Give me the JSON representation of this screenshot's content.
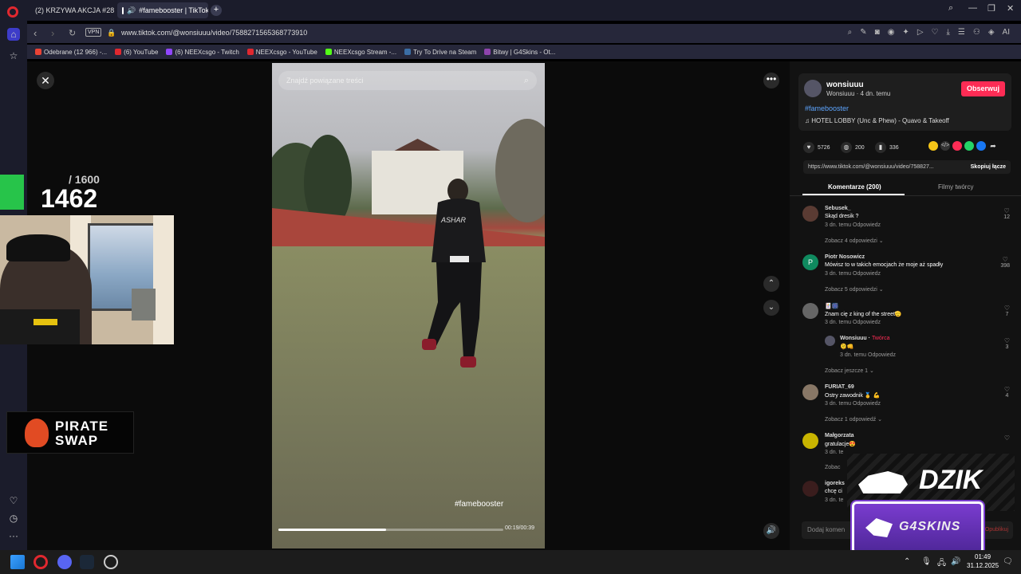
{
  "browser": {
    "tabs": [
      {
        "label": "(2) KRZYWA AKCJA #28 -",
        "color": "#e0282f"
      },
      {
        "label": "#famebooster | TikTok",
        "color": "#ffffff"
      }
    ],
    "url": "www.tiktok.com/@wonsiuuu/video/7588271565368773910",
    "vpn": "VPN",
    "bookmarks": [
      {
        "label": "Odebrane (12 966) -...",
        "color": "#ea4335"
      },
      {
        "label": "(6) YouTube",
        "color": "#e0282f"
      },
      {
        "label": "(6) NEEXcsgo - Twitch",
        "color": "#9146ff"
      },
      {
        "label": "NEEXcsgo - YouTube",
        "color": "#e0282f"
      },
      {
        "label": "NEEXcsgo Stream -...",
        "color": "#53fc18"
      },
      {
        "label": "Try To Drive na Steam",
        "color": "#3b6ea5"
      },
      {
        "label": "Bitwy | G4Skins - Ot...",
        "color": "#8e44ad"
      }
    ]
  },
  "video": {
    "search_placeholder": "Znajdź powiązane treści",
    "hashtag_overlay": "#famebooster",
    "progress": 0.48,
    "time": "00:19/00:39"
  },
  "panel": {
    "username": "wonsiuuu",
    "subline": "Wonsiuuu · 4 dn. temu",
    "follow_label": "Obserwuj",
    "hashtag": "#famebooster",
    "music": "HOTEL LOBBY (Unc & Phew) - Quavo & Takeoff",
    "likes": "5726",
    "comments_count": "200",
    "saves": "336",
    "link": "https://www.tiktok.com/@wonsiuuu/video/758827...",
    "copy_label": "Skopiuj łącze",
    "tab_comments": "Komentarze (200)",
    "tab_creator": "Filmy twórcy",
    "comments": [
      {
        "name": "Sebusek_",
        "text": "Skąd dresik ?",
        "meta": "3 dn. temu     Odpowiedz",
        "likes": "12",
        "more": "Zobacz 4 odpowiedzi ⌄",
        "avatar": "#5a3b33"
      },
      {
        "name": "Piotr Nosowicz",
        "text": "Mówisz to w takich emocjach że moje aż spadły",
        "meta": "3 dn. temu     Odpowiedz",
        "likes": "398",
        "more": "Zobacz 5 odpowiedzi ⌄",
        "avatar": "#0f8a5f",
        "initial": "P"
      },
      {
        "name": "🃏🎆",
        "text": "Znam cię z king of the street🫡",
        "meta": "3 dn. temu     Odpowiedz",
        "likes": "7",
        "more": "",
        "avatar": "#666"
      },
      {
        "name": "FURIAT_69",
        "text": "Ostry zawodnik 🥇 💪",
        "meta": "3 dn. temu     Odpowiedz",
        "likes": "4",
        "more": "Zobacz 1 odpowiedź ⌄",
        "avatar": "#887766"
      },
      {
        "name": "Małgorzata",
        "text": "gratulacje😍",
        "meta": "3 dn. te",
        "likes": "",
        "more": "Zobac",
        "avatar": "#c8b400"
      },
      {
        "name": "igoreks",
        "text": "chcę ci",
        "meta": "3 dn. te",
        "likes": "",
        "more": "",
        "avatar": "#3a1d1d"
      }
    ],
    "reply": {
      "name": "Wonsiuuu",
      "badge": "Twórca",
      "text": "🫠👊",
      "meta": "3 dn. temu     Odpowiedz",
      "likes": "3",
      "more": "Zobacz jeszcze 1 ⌄"
    },
    "add_comment": "Dodaj komen",
    "publish": "Opublikuj"
  },
  "overlay": {
    "total": "/ 1600",
    "count": "1462",
    "pirate_line1": "PIRATE",
    "pirate_line2": "SWAP",
    "dzik": "DZIK",
    "g4": "G4SKINS"
  },
  "taskbar": {
    "time": "01:49",
    "date": "31.12.2025"
  }
}
